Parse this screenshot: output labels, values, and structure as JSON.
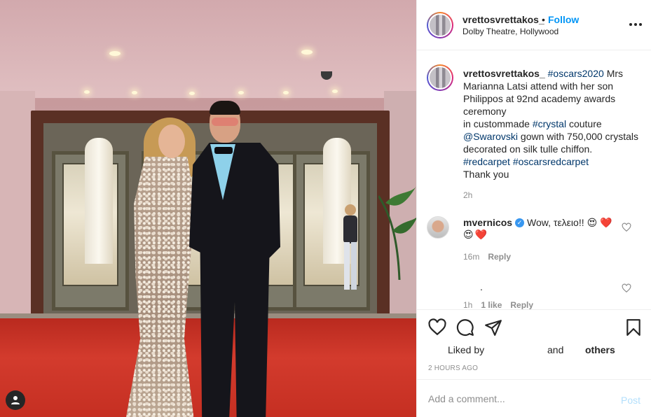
{
  "header": {
    "username": "vrettosvrettakos_",
    "separator": "•",
    "follow_label": "Follow",
    "location": "Dolby Theatre, Hollywood",
    "more_icon": "more-horizontal-icon"
  },
  "caption": {
    "username": "vrettosvrettakos_",
    "hashtag1": "#oscars2020",
    "line1": "Mrs Marianna Latsi attend with her son Philippos at 92nd academy awards ceremony",
    "line2_pre": "in custommade ",
    "hashtag2": "#crystal",
    "line2_post": " couture",
    "mention": "@Swarovski",
    "line3": " gown with 750,000 crystals decorated on silk tulle chiffon.",
    "hashtag3": "#redcarpet",
    "hashtag4": "#oscarsredcarpet",
    "thanks": "Thank you",
    "time": "2h"
  },
  "comments": [
    {
      "username": "mvernicos",
      "text": "Wow, τελειο!!",
      "emojis_line1": [
        "😍",
        "❤️"
      ],
      "emojis_line2": [
        "😍",
        "❤️"
      ],
      "time": "16m",
      "reply_label": "Reply"
    },
    {
      "text": ".",
      "time": "1h",
      "likes": "1 like",
      "reply_label": "Reply"
    }
  ],
  "actions": {
    "liked_by": "Liked by",
    "and": "and",
    "others": "others",
    "time_ago": "2 HOURS AGO"
  },
  "add_comment": {
    "placeholder": "Add a comment...",
    "post_label": "Post"
  },
  "colors": {
    "accent": "#0095f6",
    "hashtag": "#00376b",
    "post_disabled": "#b2dffc",
    "muted": "#8e8e8e"
  }
}
